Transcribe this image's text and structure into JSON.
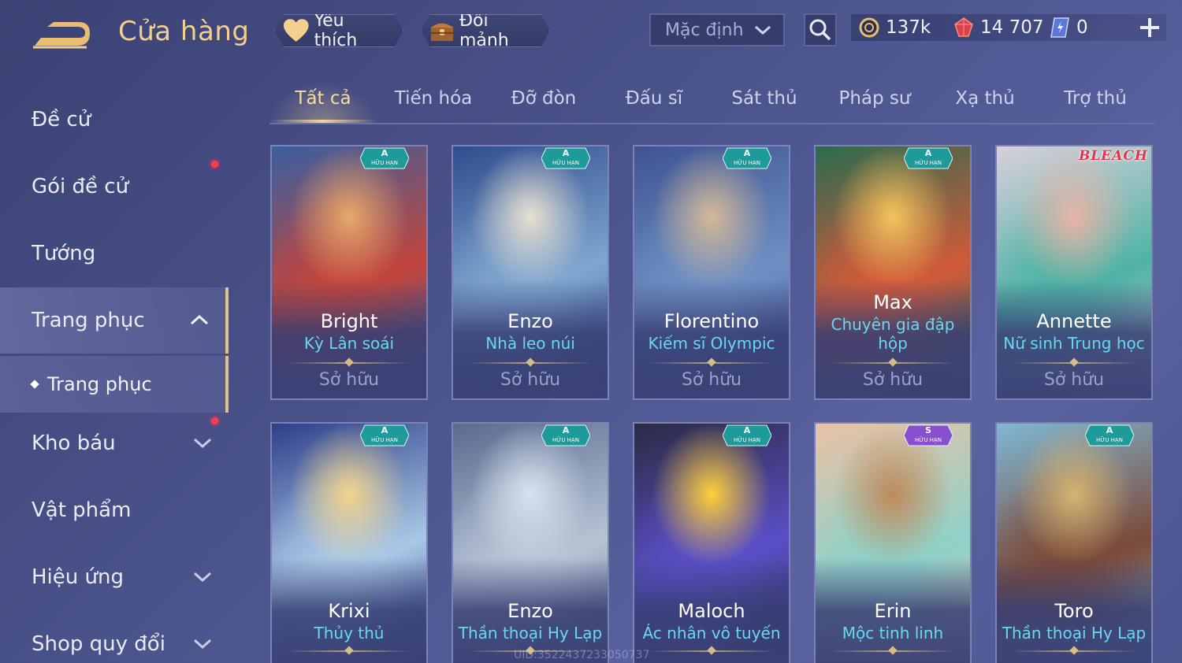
{
  "header": {
    "title": "Cửa hàng",
    "favorite_label": "Yêu thích",
    "exchange_label": "Đổi mảnh",
    "sort_value": "Mặc định",
    "gold": "137k",
    "gems": "14 707",
    "vouchers": "0"
  },
  "sidebar": {
    "items": [
      {
        "label": "Đề cử"
      },
      {
        "label": "Gói đề cử"
      },
      {
        "label": "Tướng"
      },
      {
        "label": "Trang phục"
      },
      {
        "label": "Kho báu"
      },
      {
        "label": "Vật phẩm"
      },
      {
        "label": "Hiệu ứng"
      },
      {
        "label": "Shop quy đổi"
      }
    ],
    "sub_item": "Trang phục"
  },
  "tabs": [
    "Tất cả",
    "Tiến hóa",
    "Đỡ đòn",
    "Đấu sĩ",
    "Sát thủ",
    "Pháp sư",
    "Xạ thủ",
    "Trợ thủ"
  ],
  "cards": [
    {
      "hero": "Bright",
      "skin": "Kỳ Lân soái",
      "status": "Sở hữu",
      "tier": "A",
      "tag": "HỮU HẠN"
    },
    {
      "hero": "Enzo",
      "skin": "Nhà leo núi",
      "status": "Sở hữu",
      "tier": "A",
      "tag": "HỮU HẠN"
    },
    {
      "hero": "Florentino",
      "skin": "Kiếm sĩ Olympic",
      "status": "Sở hữu",
      "tier": "A",
      "tag": "HỮU HẠN"
    },
    {
      "hero": "Max",
      "skin": "Chuyên gia đập hộp",
      "status": "Sở hữu",
      "tier": "A",
      "tag": "HỮU HẠN"
    },
    {
      "hero": "Annette",
      "skin": "Nữ sinh Trung học",
      "status": "Sở hữu",
      "logo": "BLEACH"
    },
    {
      "hero": "Krixi",
      "skin": "Thủy thủ",
      "tier": "A",
      "tag": "HỮU HẠN"
    },
    {
      "hero": "Enzo",
      "skin": "Thần thoại Hy Lạp",
      "tier": "A",
      "tag": "HỮU HẠN"
    },
    {
      "hero": "Maloch",
      "skin": "Ác nhân vô tuyến",
      "tier": "A",
      "tag": "HỮU HẠN"
    },
    {
      "hero": "Erin",
      "skin": "Mộc tinh linh",
      "tier": "S",
      "tag": "HỮU HẠN"
    },
    {
      "hero": "Toro",
      "skin": "Thần thoại Hy Lạp",
      "tier": "A",
      "tag": "HỮU HẠN"
    }
  ],
  "uid_watermark": "UID:3522437233050737",
  "colors": {
    "accent_gold": "#f0cf8f",
    "skin_name_cyan": "#6ad7ee",
    "notification_red": "#ff3b4e",
    "badge_teal": "#1f9a9a",
    "badge_purple": "#8a4fd0"
  }
}
